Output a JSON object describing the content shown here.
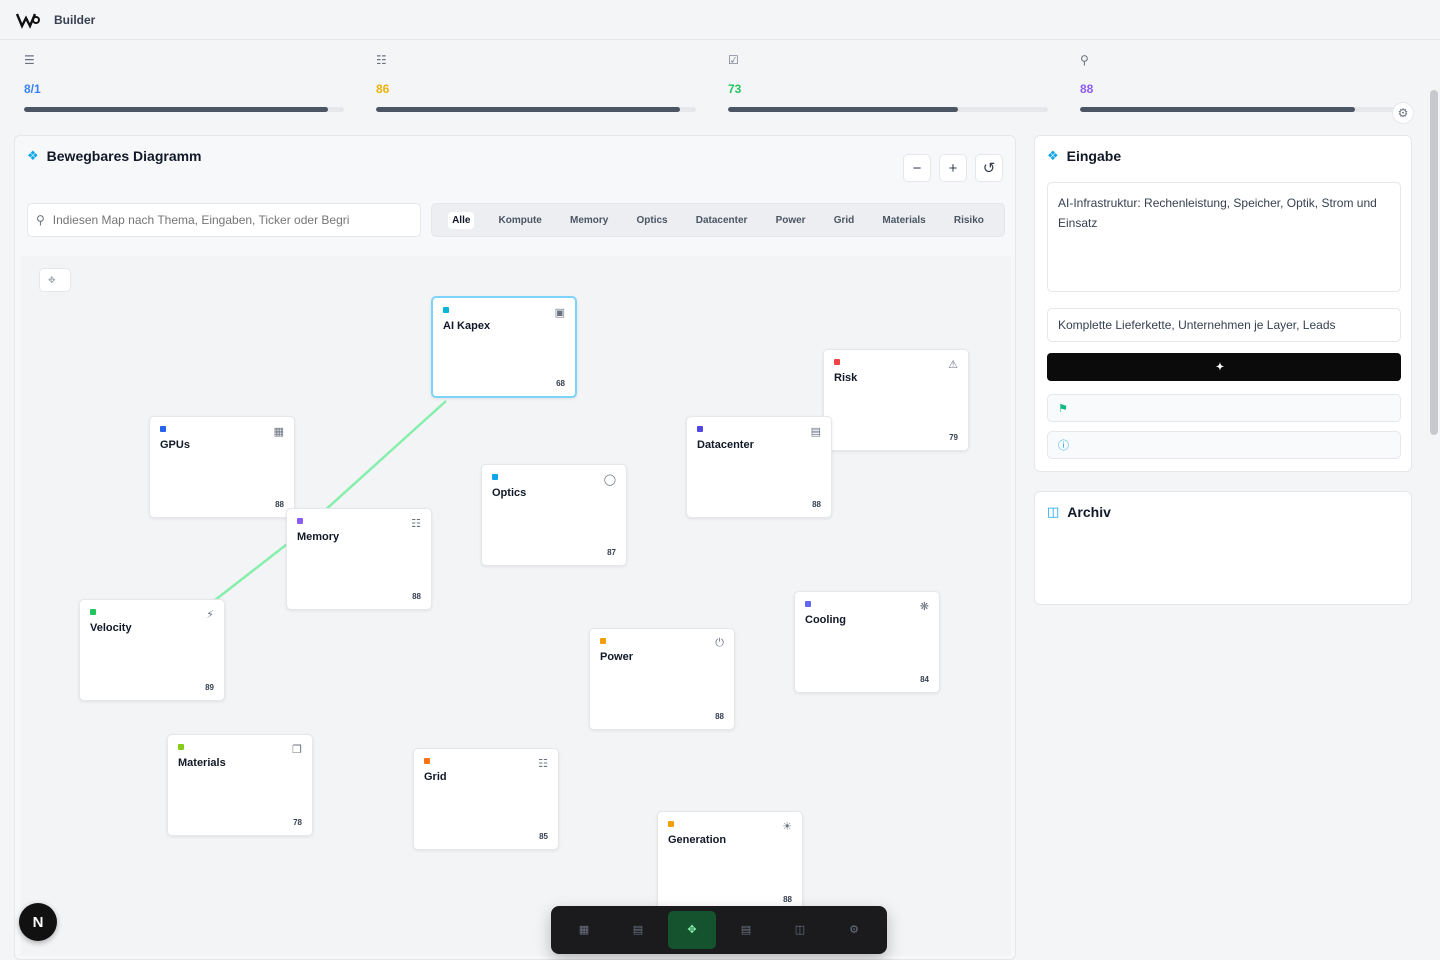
{
  "app": {
    "title": "Builder"
  },
  "stats": [
    {
      "label": "",
      "value": "8/1",
      "color": "#3b82f6",
      "progress": 0.95,
      "icon": "layers-icon"
    },
    {
      "label": "",
      "value": "86",
      "color": "#eab308",
      "progress": 0.95,
      "icon": "network-icon"
    },
    {
      "label": "",
      "value": "73",
      "color": "#22c55e",
      "progress": 0.72,
      "icon": "check-icon"
    },
    {
      "label": "",
      "value": "88",
      "color": "#8b5cf6",
      "progress": 0.86,
      "icon": "pin-icon"
    }
  ],
  "graph": {
    "title": "Bewegbares Diagramm",
    "subtitle": "",
    "search_placeholder": "Indiesen Map nach Thema, Eingaben, Ticker oder Begri",
    "filters": [
      "Alle",
      "Kompute",
      "Memory",
      "Optics",
      "Datacenter",
      "Power",
      "Grid",
      "Materials",
      "Risiko"
    ],
    "active_filter": "Alle",
    "hint": ""
  },
  "nodes": [
    {
      "title": "AI Kapex",
      "desc": "",
      "foot": "",
      "count": "68",
      "color": "#06b6d4",
      "icon": "chip-icon",
      "selected": true
    },
    {
      "title": "Risk",
      "desc": "",
      "foot": "",
      "count": "79",
      "color": "#ef4444",
      "icon": "alert-icon"
    },
    {
      "title": "GPUs",
      "desc": "",
      "foot": "",
      "count": "88",
      "color": "#2563eb",
      "icon": "gpu-icon"
    },
    {
      "title": "Datacenter",
      "desc": "",
      "foot": "",
      "count": "88",
      "color": "#4f46e5",
      "icon": "server-icon"
    },
    {
      "title": "Optics",
      "desc": "",
      "foot": "",
      "count": "87",
      "color": "#0ea5e9",
      "icon": "optics-icon"
    },
    {
      "title": "Memory",
      "desc": "",
      "foot": "",
      "count": "88",
      "color": "#8b5cf6",
      "icon": "memory-icon"
    },
    {
      "title": "Velocity",
      "desc": "",
      "foot": "",
      "count": "89",
      "color": "#22c55e",
      "icon": "bolt-icon"
    },
    {
      "title": "Power",
      "desc": "",
      "foot": "",
      "count": "88",
      "color": "#f59e0b",
      "icon": "power-icon"
    },
    {
      "title": "Cooling",
      "desc": "",
      "foot": "",
      "count": "84",
      "color": "#6366f1",
      "icon": "fan-icon"
    },
    {
      "title": "Materials",
      "desc": "",
      "foot": "",
      "count": "78",
      "color": "#84cc16",
      "icon": "cube-icon"
    },
    {
      "title": "Grid",
      "desc": "",
      "foot": "",
      "count": "85",
      "color": "#f97316",
      "icon": "grid-icon"
    },
    {
      "title": "Generation",
      "desc": "",
      "foot": "",
      "count": "88",
      "color": "#f59e0b",
      "icon": "plant-icon"
    }
  ],
  "input_panel": {
    "title": "Eingabe",
    "prompt": "AI-Infrastruktur: Rechenleistung, Speicher, Optik, Strom und Einsatz",
    "scope": "Komplette Lieferkette, Unternehmen je Layer, Leads",
    "run_label": "",
    "status_1": "",
    "status_2": ""
  },
  "archive_panel": {
    "title": "Archiv",
    "text": ""
  },
  "dock": {
    "items": [
      {
        "label": "",
        "icon": "grid-icon"
      },
      {
        "label": "",
        "icon": "layers-icon"
      },
      {
        "label": "",
        "icon": "network-icon"
      },
      {
        "label": "",
        "icon": "document-icon"
      },
      {
        "label": "",
        "icon": "archive-icon"
      },
      {
        "label": "",
        "icon": "settings-icon"
      }
    ]
  },
  "next_badge": "N"
}
